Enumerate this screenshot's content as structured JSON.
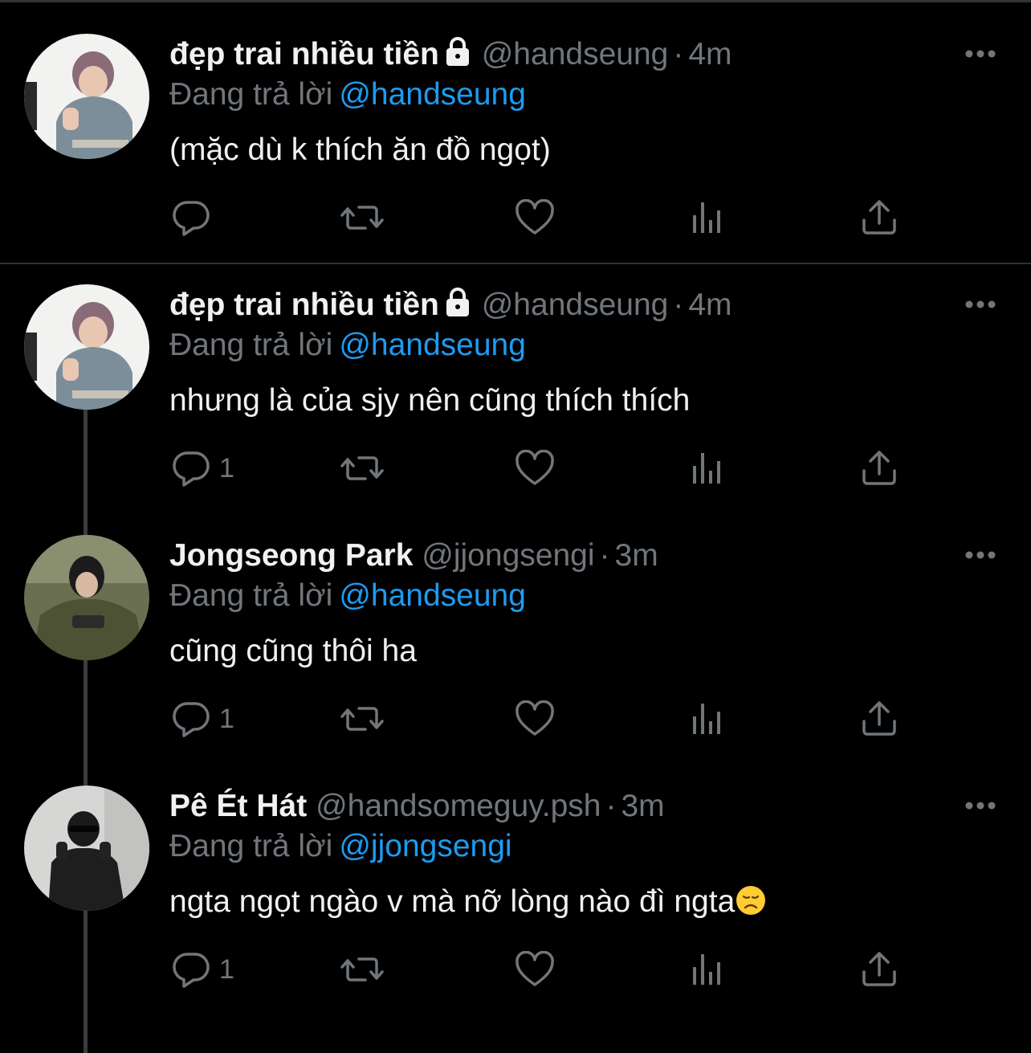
{
  "tweets": [
    {
      "name": "đẹp trai nhiều tiền",
      "locked": true,
      "handle": "@handseung",
      "sep": "·",
      "time": "4m",
      "reply_prefix": "Đang trả lời",
      "reply_to": "@handseung",
      "text": "(mặc dù k thích ăn đồ ngọt)",
      "reply_count": "",
      "avatar_icon": "person-grey-hoodie-avatar"
    },
    {
      "name": "đẹp trai nhiều tiền",
      "locked": true,
      "handle": "@handseung",
      "sep": "·",
      "time": "4m",
      "reply_prefix": "Đang trả lời",
      "reply_to": "@handseung",
      "text": "nhưng là của sjy nên cũng thích thích",
      "reply_count": "1",
      "avatar_icon": "person-grey-hoodie-avatar"
    },
    {
      "name": "Jongseong Park",
      "locked": false,
      "handle": "@jjongsengi",
      "sep": "·",
      "time": "3m",
      "reply_prefix": "Đang trả lời",
      "reply_to": "@handseung",
      "text": "cũng cũng thôi ha",
      "reply_count": "1",
      "avatar_icon": "person-olive-jacket-avatar"
    },
    {
      "name": "Pê Ét Hát",
      "locked": false,
      "handle": "@handsomeguy.psh",
      "sep": "·",
      "time": "3m",
      "reply_prefix": "Đang trả lời",
      "reply_to": "@jjongsengi",
      "text": "ngta ngọt ngào v mà nỡ lòng nào đì ngta",
      "reply_count": "1",
      "avatar_icon": "person-black-outfit-avatar",
      "trailing_emoji": "disappointed-face-emoji"
    }
  ],
  "colors": {
    "background": "#000000",
    "text": "#e7e9ea",
    "muted": "#71767b",
    "link": "#1d9bf0",
    "divider": "#2f3336"
  }
}
